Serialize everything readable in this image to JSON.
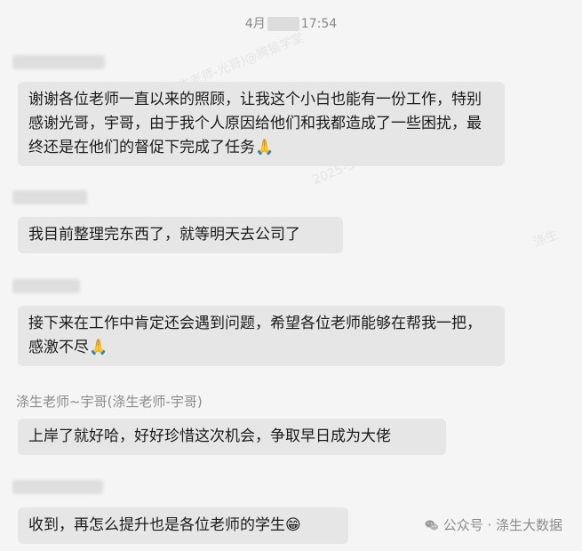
{
  "timestamp": {
    "prefix": "4月",
    "suffix": "17:54"
  },
  "messages": [
    {
      "text": "谢谢各位老师一直以来的照顾，让我这个小白也能有一份工作，特别感谢光哥，宇哥，由于我个人原因给他们和我都造成了一些困扰，最终还是在他们的督促下完成了任务",
      "emoji": "🙏"
    },
    {
      "text": "我目前整理完东西了，就等明天去公司了",
      "emoji": ""
    },
    {
      "text": "接下来在工作中肯定还会遇到问题，希望各位老师能够在帮我一把，感激不尽",
      "emoji": "🙏"
    },
    {
      "sender": "涤生老师~宇哥(涤生老师-宇哥)",
      "text": "上岸了就好哈，好好珍惜这次机会，争取早日成为大佬",
      "emoji": ""
    },
    {
      "text": "收到，再怎么提升也是各位老师的学生",
      "emoji": "😁"
    }
  ],
  "watermarks": [
    "涤生(涤生老师-光哥)@腾猿学堂",
    "2025-5-16",
    "涤生",
    "2025-5-16"
  ],
  "footer": {
    "label": "公众号 · 涤生大数据",
    "icon": "wechat-icon"
  }
}
